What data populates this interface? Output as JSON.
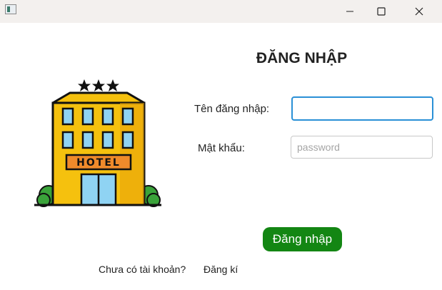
{
  "window": {
    "icon": "app-window-icon",
    "controls": [
      "minimize-icon",
      "maximize-icon",
      "close-icon"
    ]
  },
  "login": {
    "title": "ĐĂNG NHẬP",
    "username_label": "Tên đăng nhập:",
    "username_value": "",
    "password_label": "Mật khẩu:",
    "password_placeholder": "password",
    "submit_label": "Đăng nhập",
    "no_account_text": "Chưa có tài khoản?",
    "register_link": "Đăng kí"
  },
  "illustration": {
    "icon": "hotel-building-icon",
    "sign_text": "HOTEL"
  },
  "colors": {
    "accent_focus": "#2a90d6",
    "button_green": "#138613",
    "building_yellow": "#f5c10e"
  }
}
